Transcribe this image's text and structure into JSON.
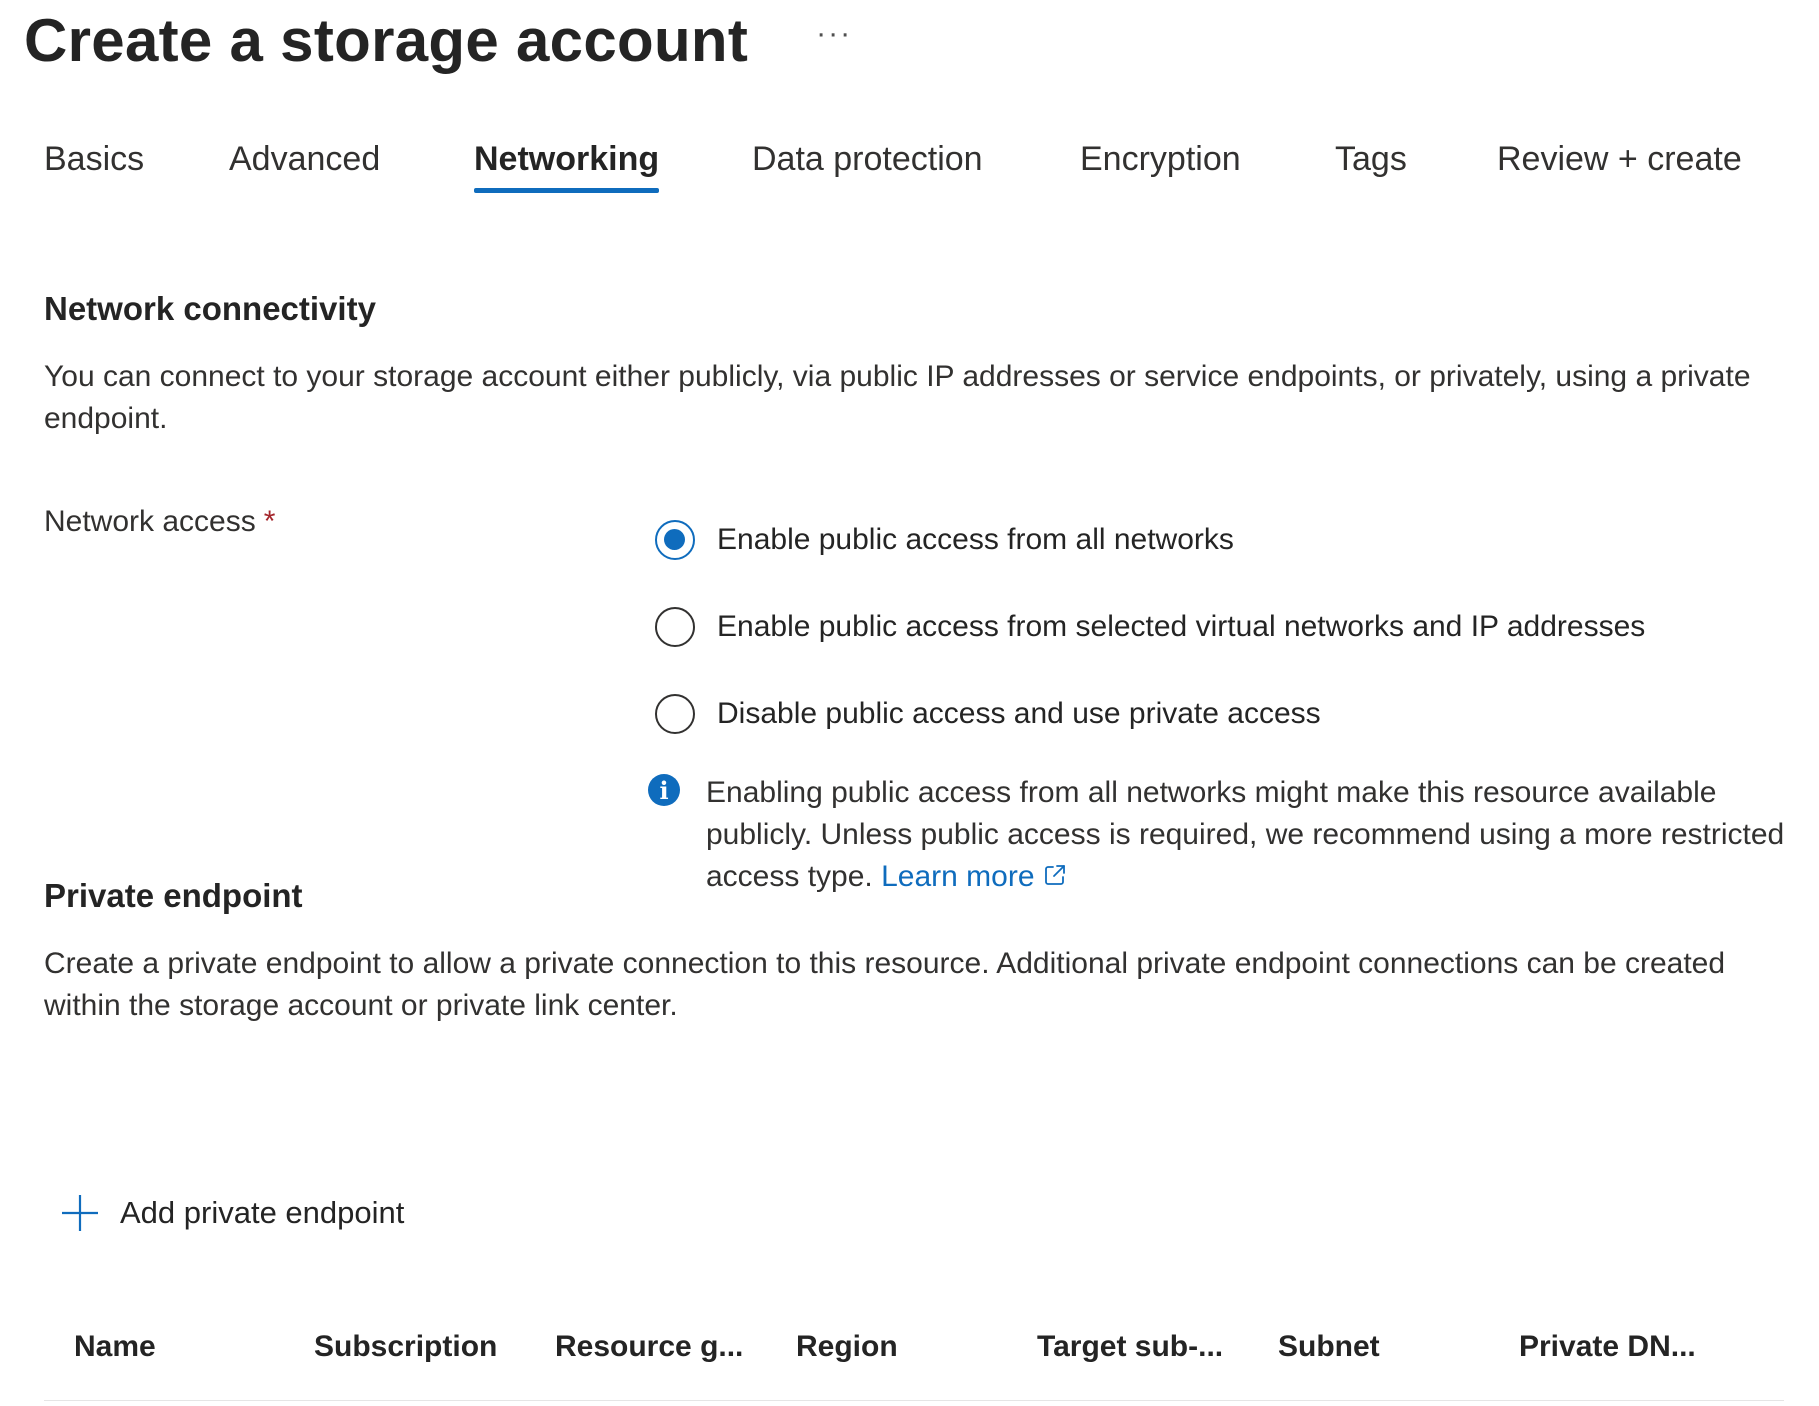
{
  "header": {
    "title": "Create a storage account",
    "more_label": "···"
  },
  "tabs": [
    {
      "label": "Basics",
      "active": false
    },
    {
      "label": "Advanced",
      "active": false
    },
    {
      "label": "Networking",
      "active": true
    },
    {
      "label": "Data protection",
      "active": false
    },
    {
      "label": "Encryption",
      "active": false
    },
    {
      "label": "Tags",
      "active": false
    },
    {
      "label": "Review + create",
      "active": false
    }
  ],
  "network_connectivity": {
    "heading": "Network connectivity",
    "description": "You can connect to your storage account either publicly, via public IP addresses or service endpoints, or privately, using a private endpoint.",
    "field_label": "Network access",
    "required_marker": "*",
    "options": [
      {
        "label": "Enable public access from all networks",
        "selected": true
      },
      {
        "label": "Enable public access from selected virtual networks and IP addresses",
        "selected": false
      },
      {
        "label": "Disable public access and use private access",
        "selected": false
      }
    ],
    "info": {
      "icon": "info-icon",
      "text": "Enabling public access from all networks might make this resource available publicly. Unless public access is required, we recommend using a more restricted access type.",
      "link_label": "Learn more",
      "link_icon": "external-link-icon"
    }
  },
  "private_endpoint": {
    "heading": "Private endpoint",
    "description": "Create a private endpoint to allow a private connection to this resource. Additional private endpoint connections can be created within the storage account or private link center.",
    "add_button_label": "Add private endpoint",
    "add_icon": "plus-icon",
    "columns": [
      "Name",
      "Subscription",
      "Resource g...",
      "Region",
      "Target sub-...",
      "Subnet",
      "Private DN..."
    ]
  },
  "colors": {
    "accent": "#0f6cbd",
    "required": "#a4262c",
    "text": "#242424"
  }
}
